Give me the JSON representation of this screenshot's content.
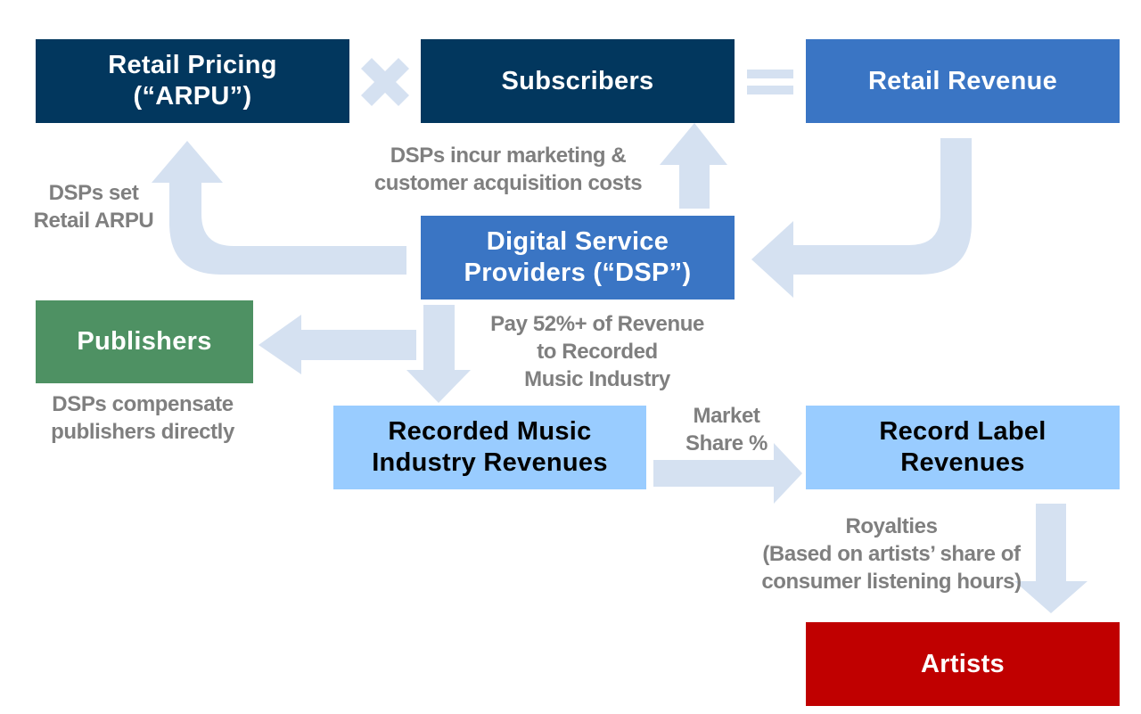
{
  "boxes": {
    "retail_pricing": "Retail Pricing\n(“ARPU”)",
    "subscribers": "Subscribers",
    "retail_revenue": "Retail Revenue",
    "dsp": "Digital Service\nProviders (“DSP”)",
    "publishers": "Publishers",
    "recorded_music": "Recorded Music\nIndustry Revenues",
    "record_label": "Record Label\nRevenues",
    "artists": "Artists"
  },
  "notes": {
    "dsps_set": "DSPs set\nRetail ARPU",
    "dsps_incur": "DSPs incur marketing &\ncustomer acquisition costs",
    "pay": "Pay 52%+ of Revenue\nto Recorded\nMusic Industry",
    "compensate": "DSPs compensate\npublishers directly",
    "market_share": "Market\nShare %",
    "royalties": "Royalties\n(Based on artists’ share of\nconsumer listening hours)"
  },
  "operators": {
    "multiply": "multiply-icon",
    "equals": "equals-icon"
  },
  "colors": {
    "dark_navy": "#02375e",
    "mid_blue": "#3a75c4",
    "light_blue": "#99ccff",
    "green": "#4e9163",
    "red": "#c00000",
    "arrow": "#d5e1f1",
    "note_text": "#7f7f7f"
  }
}
